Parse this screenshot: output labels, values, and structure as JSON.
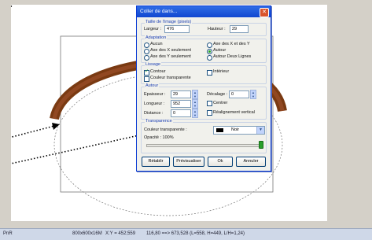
{
  "dialog": {
    "title": "Coller de dans...",
    "close_label": "x",
    "size_group": {
      "label": "Taille de l'image (pixels)",
      "width_label": "Largeur :",
      "width_value": "476",
      "height_label": "Hauteur :",
      "height_value": "29"
    },
    "adaptation_group": {
      "label": "Adaptation",
      "options": [
        {
          "label": "Aucun",
          "selected": false
        },
        {
          "label": "Axe des X et des Y",
          "selected": false
        },
        {
          "label": "Axe des X seulement",
          "selected": false
        },
        {
          "label": "Autour",
          "selected": true
        },
        {
          "label": "Axe des Y seulement",
          "selected": false
        },
        {
          "label": "Autour Deux Lignes",
          "selected": false
        }
      ]
    },
    "lissage_group": {
      "label": "Lissage",
      "contour_label": "Contour",
      "contour_checked": true,
      "interieur_label": "Intérieur",
      "interieur_checked": false,
      "transparent_label": "Couleur transparente",
      "transparent_checked": false
    },
    "autour_group": {
      "label": "Autour",
      "epaisseur_label": "Epaisseur :",
      "epaisseur_value": "29",
      "decalage_label": "Décalage :",
      "decalage_value": "0",
      "longueur_label": "Longueur :",
      "longueur_value": "952",
      "centrer_label": "Centrer",
      "distance_label": "Distance :",
      "distance_value": "0",
      "realignement_label": "Réalignement vertical"
    },
    "transparence_group": {
      "label": "Transparence",
      "couleur_label": "Couleur transparente :",
      "couleur_value": "Noir",
      "opacite_label": "Opacité : 100%",
      "opacite_fraction": 1.0
    },
    "buttons": {
      "retablir": "Rétablir",
      "previsualiser": "Prévisualiser",
      "ok": "Ok",
      "annuler": "Annuler"
    }
  },
  "status_bar": {
    "left": "PnR",
    "size": "800x600x16M",
    "coords": "X:Y = 452;559",
    "info": "116,80 ==> 673,528 (L=558, H=449, L/H=1,24)"
  },
  "colors": {
    "arc_wood": "#7a3a12",
    "dialog_title": "#1147d0",
    "status_bg": "#cfd8e8"
  }
}
